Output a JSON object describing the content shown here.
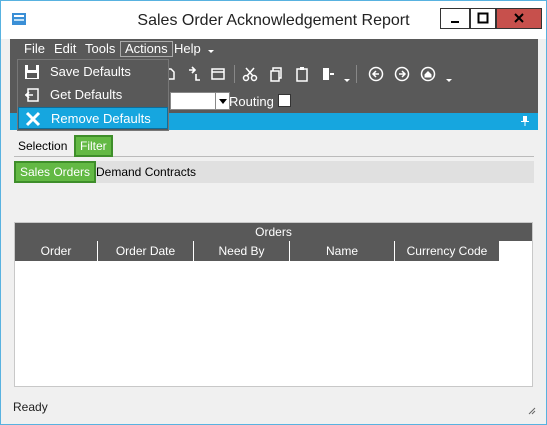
{
  "window": {
    "title": "Sales Order Acknowledgement Report"
  },
  "menubar": {
    "items": [
      "File",
      "Edit",
      "Tools",
      "Actions",
      "Help"
    ],
    "active": "Actions"
  },
  "actions_menu": {
    "items": [
      {
        "label": "Save Defaults",
        "icon": "floppy-disk-icon",
        "highlighted": false
      },
      {
        "label": "Get Defaults",
        "icon": "import-icon",
        "highlighted": false
      },
      {
        "label": "Remove Defaults",
        "icon": "remove-x-icon",
        "highlighted": true
      }
    ]
  },
  "routing": {
    "label": "Routing",
    "checked": false
  },
  "tabs": {
    "main": [
      "Selection",
      "Filter"
    ],
    "main_active": "Filter",
    "sub": [
      "Sales Orders",
      "Demand Contracts"
    ],
    "sub_active": "Sales Orders"
  },
  "grid": {
    "title": "Orders",
    "columns": [
      "Order",
      "Order Date",
      "Need By",
      "Name",
      "Currency Code"
    ],
    "rows": []
  },
  "status": {
    "text": "Ready"
  },
  "colors": {
    "dark_bg": "#595959",
    "accent_blue": "#16a6df",
    "tab_green": "#63b944",
    "close_red": "#c7504c"
  }
}
